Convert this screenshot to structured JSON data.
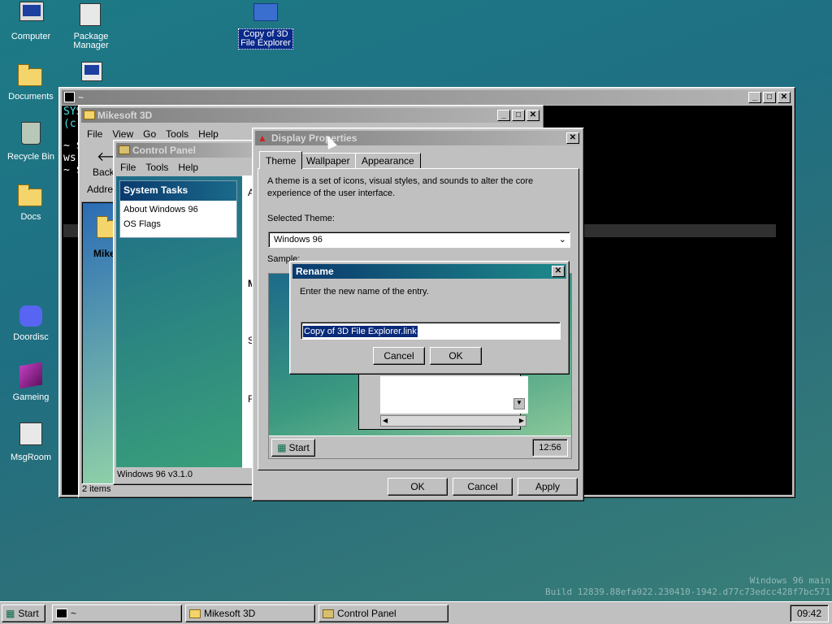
{
  "desktop": {
    "icons": [
      {
        "label": "Computer"
      },
      {
        "label": "Package Manager"
      },
      {
        "label": "Copy of 3D File Explorer"
      },
      {
        "label": "Documents"
      },
      {
        "label": "Recycle Bin"
      },
      {
        "label": "Docs"
      },
      {
        "label": "Doordisc"
      },
      {
        "label": "Gameing"
      },
      {
        "label": "MsgRoom"
      }
    ],
    "watermark_line1": "Windows 96 main",
    "watermark_line2": "Build 12839.88efa922.230410-1942.d77c73edcc428f7bc571"
  },
  "terminal": {
    "title": "~",
    "lines": [
      "SYS",
      "(c",
      "~ $",
      "ws",
      "~ $"
    ]
  },
  "explorer": {
    "title": "Mikesoft 3D",
    "menu": [
      "File",
      "View",
      "Go",
      "Tools",
      "Help"
    ],
    "back_label": "Back",
    "address_label": "Addres",
    "item_label": "Mike",
    "status": "2 items"
  },
  "control_panel": {
    "title": "Control Panel",
    "menu": [
      "File",
      "Tools",
      "Help"
    ],
    "tasks_header": "System Tasks",
    "tasks": [
      "About Windows 96",
      "OS Flags"
    ],
    "status": "Windows 96 v3.1.0",
    "partial_letters": [
      "A",
      "M",
      "S",
      "F"
    ]
  },
  "display_props": {
    "title": "Display Properties",
    "tabs": [
      "Theme",
      "Wallpaper",
      "Appearance"
    ],
    "description": "A theme is a set of icons, visual styles, and sounds to alter the core experience of the user interface.",
    "selected_theme_label": "Selected Theme:",
    "selected_theme_value": "Windows 96",
    "sample_label": "Sample:",
    "sample_start": "Start",
    "sample_clock": "12:56",
    "ok": "OK",
    "cancel": "Cancel",
    "apply": "Apply"
  },
  "rename": {
    "title": "Rename",
    "prompt": "Enter the new name of the entry.",
    "value": "Copy of 3D File Explorer.link",
    "cancel": "Cancel",
    "ok": "OK"
  },
  "taskbar": {
    "start": "Start",
    "items": [
      "~",
      "Mikesoft 3D",
      "Control Panel"
    ],
    "clock": "09:42"
  },
  "colors": {
    "accent": "#0a3a6e",
    "desktop": "#1f7282"
  }
}
